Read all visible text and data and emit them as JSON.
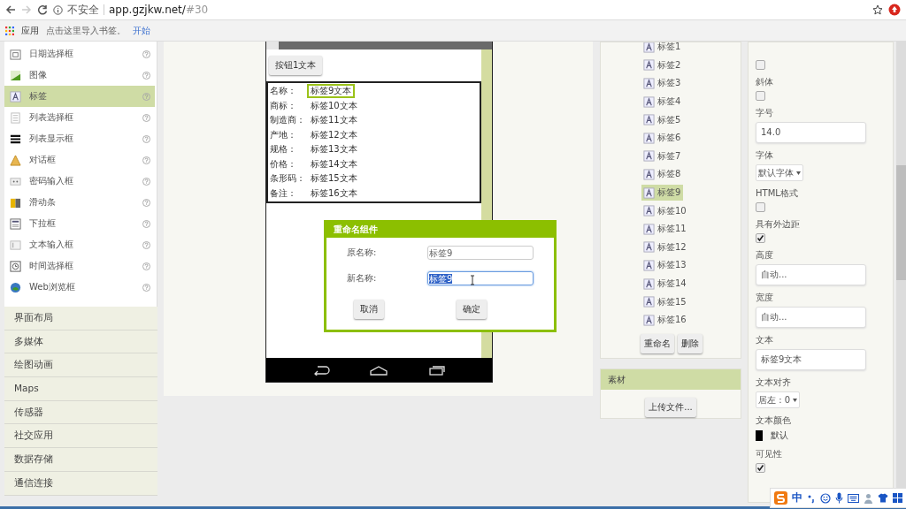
{
  "browser": {
    "security": "不安全",
    "url": "app.gzjkw.net/",
    "fragment": "#30"
  },
  "bookmarks": {
    "apps": "应用",
    "hint": "点击这里导入书签。",
    "link": "开始"
  },
  "palette": {
    "items": [
      {
        "label": "日期选择框",
        "selected": false
      },
      {
        "label": "图像",
        "selected": false
      },
      {
        "label": "标签",
        "selected": true
      },
      {
        "label": "列表选择框",
        "selected": false
      },
      {
        "label": "列表显示框",
        "selected": false
      },
      {
        "label": "对话框",
        "selected": false
      },
      {
        "label": "密码输入框",
        "selected": false
      },
      {
        "label": "滑动条",
        "selected": false
      },
      {
        "label": "下拉框",
        "selected": false
      },
      {
        "label": "文本输入框",
        "selected": false
      },
      {
        "label": "时间选择框",
        "selected": false
      },
      {
        "label": "Web浏览框",
        "selected": false
      }
    ],
    "categories": [
      "界面布局",
      "多媒体",
      "绘图动画",
      "Maps",
      "传感器",
      "社交应用",
      "数据存储",
      "通信连接"
    ]
  },
  "viewer": {
    "button": "按钮1文本",
    "rows": [
      {
        "label": "名称：",
        "value": "标签9文本",
        "selected": true
      },
      {
        "label": "商标：",
        "value": "标签10文本",
        "selected": false
      },
      {
        "label": "制造商：",
        "value": "标签11文本",
        "selected": false
      },
      {
        "label": "产地：",
        "value": "标签12文本",
        "selected": false
      },
      {
        "label": "规格：",
        "value": "标签13文本",
        "selected": false
      },
      {
        "label": "价格：",
        "value": "标签14文本",
        "selected": false
      },
      {
        "label": "条形码：",
        "value": "标签15文本",
        "selected": false
      },
      {
        "label": "备注：",
        "value": "标签16文本",
        "selected": false
      }
    ]
  },
  "dialog": {
    "title": "重命名组件",
    "fields": [
      {
        "label": "原名称:",
        "value": "标签9",
        "selected": false
      },
      {
        "label": "新名称:",
        "value": "标签9",
        "selected": true
      }
    ],
    "buttons": [
      "取消",
      "确定"
    ]
  },
  "tree": {
    "items": [
      {
        "label": "标签1",
        "selected": false
      },
      {
        "label": "标签2",
        "selected": false
      },
      {
        "label": "标签3",
        "selected": false
      },
      {
        "label": "标签4",
        "selected": false
      },
      {
        "label": "标签5",
        "selected": false
      },
      {
        "label": "标签6",
        "selected": false
      },
      {
        "label": "标签7",
        "selected": false
      },
      {
        "label": "标签8",
        "selected": false
      },
      {
        "label": "标签9",
        "selected": true
      },
      {
        "label": "标签10",
        "selected": false
      },
      {
        "label": "标签11",
        "selected": false
      },
      {
        "label": "标签12",
        "selected": false
      },
      {
        "label": "标签13",
        "selected": false
      },
      {
        "label": "标签14",
        "selected": false
      },
      {
        "label": "标签15",
        "selected": false
      },
      {
        "label": "标签16",
        "selected": false
      }
    ],
    "buttons": [
      "重命名",
      "删除"
    ]
  },
  "media": {
    "title": "素材",
    "button": "上传文件..."
  },
  "properties": [
    {
      "kind": "checkbox",
      "checked": false
    },
    {
      "kind": "checkbox",
      "label": "斜体",
      "checked": false
    },
    {
      "kind": "text",
      "label": "字号",
      "value": "14.0"
    },
    {
      "kind": "dropdown",
      "label": "字体",
      "value": "默认字体"
    },
    {
      "kind": "checkbox",
      "label": "HTML格式",
      "checked": false
    },
    {
      "kind": "checkbox",
      "label": "具有外边距",
      "checked": true
    },
    {
      "kind": "text",
      "label": "高度",
      "value": "自动..."
    },
    {
      "kind": "text",
      "label": "宽度",
      "value": "自动..."
    },
    {
      "kind": "text",
      "label": "文本",
      "value": "标签9文本"
    },
    {
      "kind": "dropdown",
      "label": "文本对齐",
      "value": "居左 : 0"
    },
    {
      "kind": "color",
      "label": "文本颜色",
      "value": "默认",
      "color": "#000000"
    },
    {
      "kind": "checkbox",
      "label": "可见性",
      "checked": true
    }
  ],
  "ime": {
    "label": "中"
  }
}
